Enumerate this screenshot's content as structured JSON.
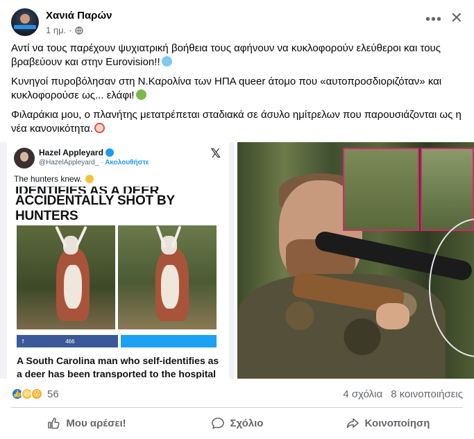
{
  "post": {
    "author": "Χανιά Παρών",
    "time": "1 ημ.",
    "paragraphs": [
      "Αντί να τους παρέχουν ψυχιατρική βοήθεια τους αφήνουν να κυκλοφορούν ελεύθεροι και τους βραβεύουν και στην Eurovision!!",
      "Κυνηγοί πυροβόλησαν στη Ν.Καρολίνα των ΗΠΑ queer άτομο που «αυτοπροσδιοριζόταν» και κυκλοφορούσε ως... ελάφι!",
      "Φιλαράκια μου, ο πλανήτης μετατρέπεται σταδιακά σε άσυλο ημίτρελων που παρουσιάζονται ως η νέα κανονικότητα."
    ]
  },
  "tweet": {
    "name": "Hazel Appleyard",
    "handle": "@HazelAppleyard_",
    "follow": "Ακολουθήστε",
    "text": "The hunters knew.",
    "headline_cut": "IDENTIFIES AS A DEER",
    "headline": "ACCIDENTALLY SHOT BY HUNTERS",
    "fb_count": "466",
    "article_text": "A South Carolina man who self-identifies as a deer has been transported to the hospital via"
  },
  "stats": {
    "reaction_count": "56",
    "comments": "4 σχόλια",
    "shares": "8 κοινοποιήσεις"
  },
  "actions": {
    "like": "Μου αρέσει!",
    "comment": "Σχόλιο",
    "share": "Κοινοποίηση"
  },
  "colors": {
    "like_blue": "#1877f2",
    "muted_text": "#65676b",
    "twitter_blue": "#1d9bf0",
    "fb_share": "#3b5998"
  },
  "icons": [
    "globe-icon",
    "more-icon",
    "close-icon",
    "x-logo-icon",
    "verified-icon",
    "like-icon",
    "comment-icon",
    "share-icon"
  ]
}
